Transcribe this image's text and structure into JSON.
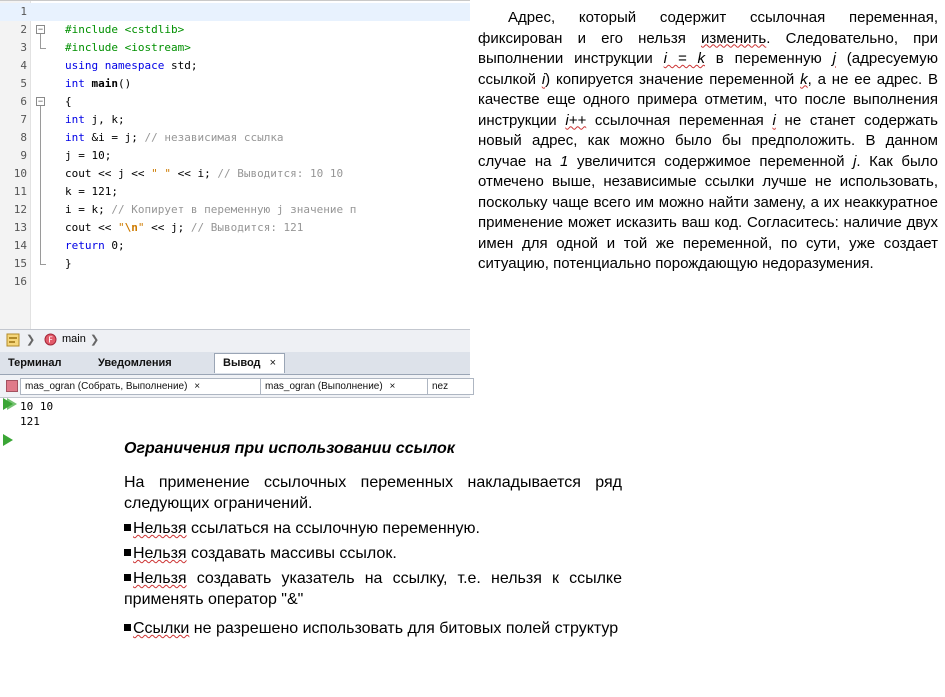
{
  "editor": {
    "line_numbers": [
      "1",
      "2",
      "3",
      "4",
      "5",
      "6",
      "7",
      "8",
      "9",
      "10",
      "11",
      "12",
      "13",
      "14",
      "15",
      "16"
    ],
    "lines": [
      {
        "type": "blank"
      },
      {
        "type": "inc",
        "kw": "#include",
        "arg": "<cstdlib>"
      },
      {
        "type": "inc",
        "kw": "#include",
        "arg": "<iostream>"
      },
      {
        "type": "using",
        "kw": "using namespace",
        "rest": " std;"
      },
      {
        "type": "main",
        "kw": "int",
        "fn": "main",
        "rest": "()"
      },
      {
        "type": "plain",
        "text": "{"
      },
      {
        "type": "decl",
        "kw": "int",
        "rest": " j, k;"
      },
      {
        "type": "declc",
        "kw": "int",
        "rest": " &i = j; ",
        "comment": "// независимая ссылка"
      },
      {
        "type": "plain",
        "text": "j = 10;"
      },
      {
        "type": "cout",
        "pre": "cout << j << ",
        "str": "\" \"",
        "post": " << i; ",
        "comment": "// Выводится: 10 10"
      },
      {
        "type": "plain",
        "text": "k = 121;"
      },
      {
        "type": "assignc",
        "pre": "i = k; ",
        "comment": "// Копирует в переменную j значение п"
      },
      {
        "type": "cout2",
        "pre": "cout << ",
        "str1": "\"",
        "esc": "\\n",
        "str2": "\"",
        "post": " << j; ",
        "comment": "// Выводится: 121"
      },
      {
        "type": "ret",
        "kw": "return",
        "rest": " 0;"
      },
      {
        "type": "plain",
        "text": "}"
      },
      {
        "type": "blank"
      }
    ]
  },
  "navbar": {
    "item": "main"
  },
  "output_tabs": {
    "terminal": "Терминал",
    "notifications": "Уведомления",
    "output": "Вывод",
    "close": "×"
  },
  "run_tabs": [
    {
      "label": "mas_ogran (Собрать, Выполнение)",
      "close": "×"
    },
    {
      "label": "mas_ogran (Выполнение)",
      "close": "×"
    },
    {
      "label": "nez",
      "close": ""
    }
  ],
  "output": {
    "lines": [
      "10 10",
      "121"
    ]
  },
  "paragraph": {
    "p1": "Адрес, который содержит ссылочная переменная, фиксирован и его нельзя ",
    "u1": "изменить",
    "p2": ". Следовательно, при выполнении инструкции ",
    "i1": "i = k",
    "p3": " в переменную ",
    "i2": "j",
    "p4": " (адресуемую ссылкой ",
    "i3": "i",
    "p5": ") копируется значение переменной ",
    "i4": "k",
    "p6": ", а не ее адрес. В качестве еще одного примера отметим, что после выполнения инструкции ",
    "i5": "i++",
    "p7": " ссылочная переменная ",
    "i6": "i",
    "p8": " не станет содержать новый адрес, как можно было бы предположить. В данном случае на ",
    "i7": "1",
    "p9": " увеличится содержимое переменной ",
    "i8": "j",
    "p10": ". Как было отмечено выше, независимые ссылки лучше не использовать, поскольку чаще всего им можно найти замену, а их неаккуратное применение может исказить ваш код. Согласитесь: наличие двух имен для одной и той же переменной, по сути, уже создает ситуацию, потенциально порождающую недоразумения."
  },
  "restrictions": {
    "title": "Ограничения при использовании ссылок",
    "intro": "На применение ссылочных переменных накладывается ряд следующих ограничений.",
    "items": [
      {
        "lead": "Нельзя",
        "rest": " ссылаться на ссылочную переменную."
      },
      {
        "lead": "Нельзя",
        "rest": " создавать массивы ссылок."
      },
      {
        "lead": "Нельзя",
        "rest": " создавать указатель на ссылку, т.е. нельзя к ссылке применять оператор \"&\""
      },
      {
        "lead": "Ссылки",
        "rest": " не разрешено использовать для битовых полей структур"
      }
    ]
  }
}
